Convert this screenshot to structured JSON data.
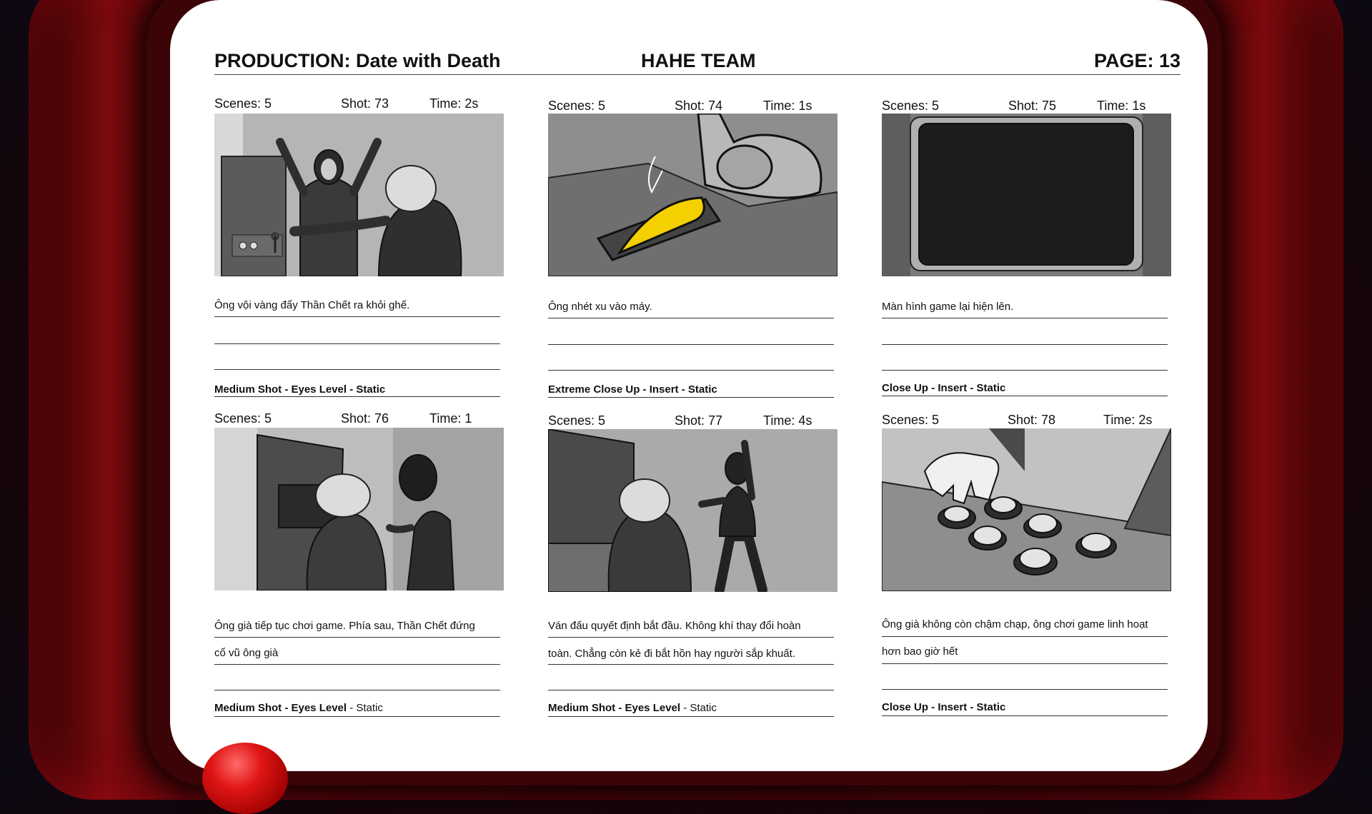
{
  "header": {
    "production": "PRODUCTION: Date with Death",
    "team": "HAHE TEAM",
    "page": "PAGE: 13"
  },
  "panels": [
    {
      "scenes": "Scenes: 5",
      "shot": "Shot: 73",
      "time": "Time: 2s",
      "desc1": "Ông vội vàng đẩy Thần Chết ra khỏi ghế.",
      "desc2": "",
      "cam_bold": "Medium Shot -  Eyes Level - Static",
      "cam_plain": "",
      "image": "old-man-pushing-hooded-death-at-arcade"
    },
    {
      "scenes": "Scenes: 5",
      "shot": "Shot: 74",
      "time": "Time: 1s",
      "desc1": "Ông nhét xu vào máy.",
      "desc2": "",
      "cam_bold": "Extreme Close Up - Insert - Static",
      "cam_plain": "",
      "image": "hand-inserting-yellow-coin-into-slot"
    },
    {
      "scenes": "Scenes: 5",
      "shot": "Shot: 75",
      "time": "Time: 1s",
      "desc1": "Màn hình game lại hiện lên.",
      "desc2": "",
      "cam_bold": "Close Up - Insert - Static",
      "cam_plain": "",
      "image": "arcade-screen-close-up"
    },
    {
      "scenes": "Scenes: 5",
      "shot": "Shot: 76",
      "time": "Time: 1",
      "desc1": "Ông già tiếp tục chơi game. Phía sau, Thần Chết đứng",
      "desc2": "cổ vũ ông già",
      "cam_bold": "Medium Shot - Eyes Level",
      "cam_plain": " - Static",
      "image": "old-man-at-arcade-cabinet-death-behind"
    },
    {
      "scenes": "Scenes: 5",
      "shot": "Shot: 77",
      "time": "Time: 4s",
      "desc1": "Ván đấu quyết định bắt đầu. Không khí thay đổi hoàn",
      "desc2": "toàn. Chẳng còn kẻ đi bắt hồn hay người sắp khuất.",
      "cam_bold": "Medium Shot - Eyes Level",
      "cam_plain": " - Static",
      "image": "old-man-playing-death-cheering"
    },
    {
      "scenes": "Scenes: 5",
      "shot": "Shot: 78",
      "time": "Time: 2s",
      "desc1": "Ông già không còn chậm chạp, ông chơi game linh hoạt",
      "desc2": "hơn bao giờ hết",
      "cam_bold": "Close Up - Insert - Static",
      "cam_plain": "",
      "image": "hand-on-arcade-buttons"
    }
  ],
  "colors": {
    "coin": "#f5d000",
    "arcade_button": "#e01515",
    "bezel": "#7a0a0e"
  }
}
